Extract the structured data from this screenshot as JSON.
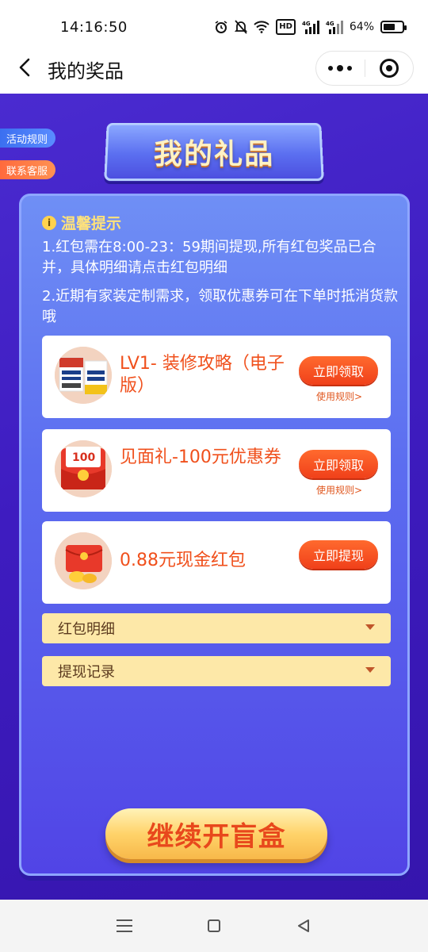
{
  "status": {
    "time": "14:16:50",
    "hd": "HD",
    "net1": "4G",
    "net2": "4G",
    "battery_pct": "64%",
    "battery_level": 0.64
  },
  "titlebar": {
    "title": "我的奖品"
  },
  "side_tabs": {
    "rules": "活动规则",
    "service": "联系客服"
  },
  "banner": {
    "title": "我的礼品"
  },
  "tips": {
    "title": "温馨提示",
    "line1": "1.红包需在8:00-23：59期间提现,所有红包奖品已合并，具体明细请点击红包明细",
    "line2": "2.近期有家装定制需求，领取优惠券可在下单时抵消货款哦"
  },
  "prizes": [
    {
      "name": "LV1- 装修攻略（电子版）",
      "button": "立即领取",
      "rule": "使用规则>"
    },
    {
      "name": "见面礼-100元优惠券",
      "button": "立即领取",
      "rule": "使用规则>",
      "coupon_amount": "100"
    },
    {
      "name": "0.88元现金红包",
      "button": "立即提现"
    }
  ],
  "accordions": {
    "detail": "红包明细",
    "records": "提现记录"
  },
  "cta": {
    "label": "继续开盲盒"
  },
  "colors": {
    "accent": "#f0501c",
    "panel": "#5c6df0",
    "background": "#3e1cc0",
    "cta": "#ffd36a"
  }
}
